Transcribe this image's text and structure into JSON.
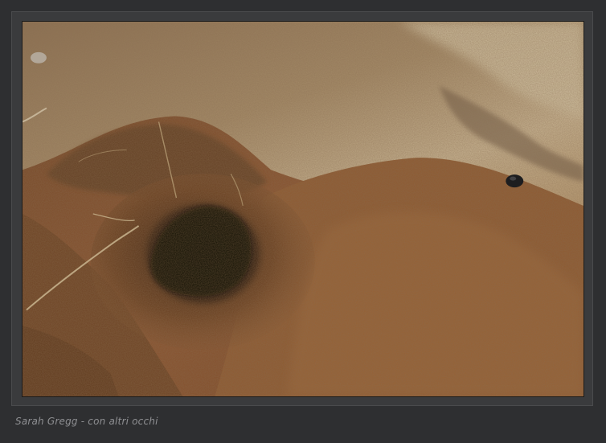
{
  "caption": "Sarah Gregg - con altri occhi",
  "photo": {
    "subject": "soil-burrow",
    "colors": {
      "frame": "#3a3b3d",
      "background": "#2e2f31",
      "soil_light": "#b8a07a",
      "soil_mid": "#8a5a30",
      "soil_dark": "#5a3418",
      "hole": "#140c06"
    }
  }
}
